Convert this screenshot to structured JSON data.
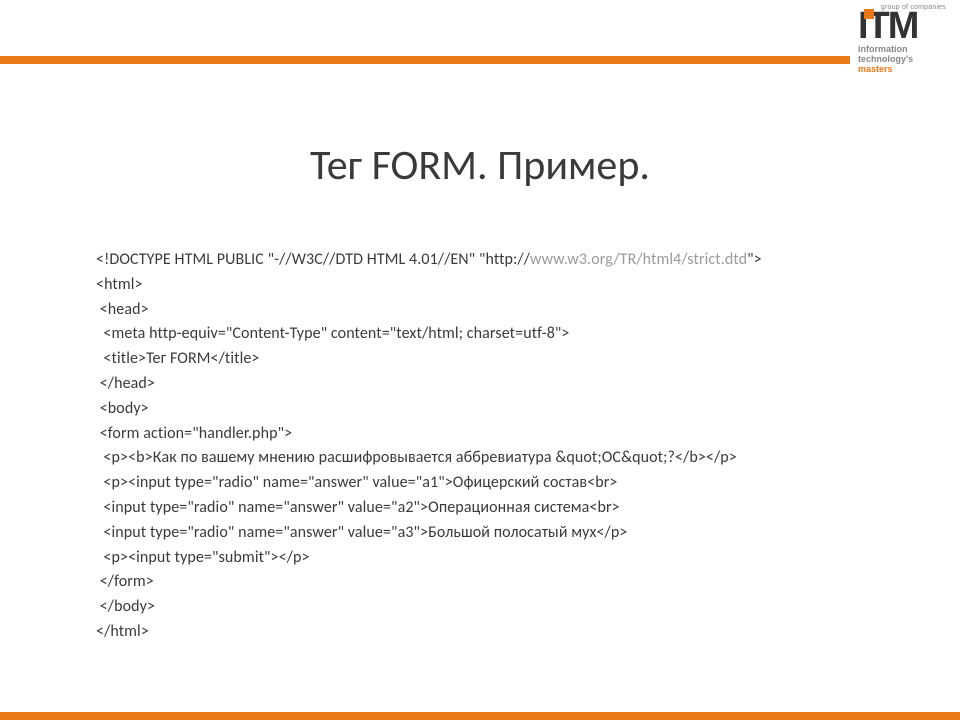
{
  "logo": {
    "group_label": "group of companies",
    "brand": "ITM",
    "tag1": "information",
    "tag2": "technology's",
    "tag3": "masters"
  },
  "title": "Тег FORM. Пример.",
  "code": {
    "l01a": "<!DOCTYPE HTML PUBLIC \"-//W3C//DTD HTML 4.01//EN\" \"http://",
    "l01b": "www.w3.org/TR/html4/strict.dtd",
    "l01c": "\">",
    "l02": "<html>",
    "l03": " <head>",
    "l04": "  <meta http-equiv=\"Content-Type\" content=\"text/html; charset=utf-8\">",
    "l05": "  <title>Тег FORM</title>",
    "l06": " </head>",
    "l07": " <body>",
    "l08": " <form action=\"handler.php\">",
    "l09": "  <p><b>Как по вашему мнению расшифровывается аббревиатура &quot;ОС&quot;?</b></p>",
    "l10": "  <p><input type=\"radio\" name=\"answer\" value=\"a1\">Офицерский состав<br>",
    "l11": "  <input type=\"radio\" name=\"answer\" value=\"a2\">Операционная система<br>",
    "l12": "  <input type=\"radio\" name=\"answer\" value=\"a3\">Большой полосатый мух</p>",
    "l13": "  <p><input type=\"submit\"></p>",
    "l14": " </form>",
    "l15": " </body>",
    "l16": "</html>"
  }
}
